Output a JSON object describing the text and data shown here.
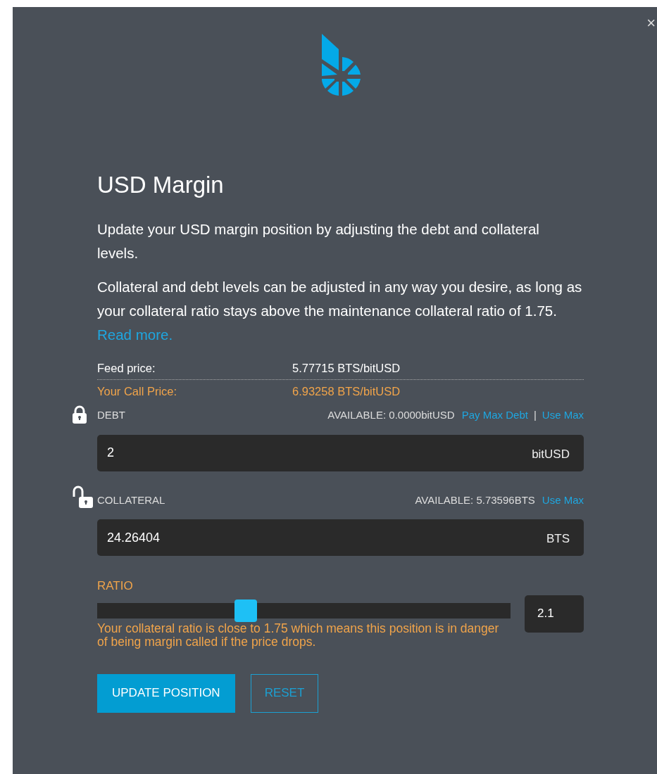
{
  "close": "×",
  "title": "USD Margin",
  "intro": "Update your USD margin position by adjusting the debt and collateral levels.",
  "description": "Collateral and debt levels can be adjusted in any way you desire, as long as your collateral ratio stays above the maintenance collateral ratio of 1.75.",
  "read_more": "Read more.",
  "prices": [
    {
      "label": "Feed price:",
      "value": "5.77715 BTS/bitUSD",
      "kind": "feed"
    },
    {
      "label": "Your Call Price:",
      "value": "6.93258 BTS/bitUSD",
      "kind": "call"
    }
  ],
  "fields": [
    {
      "label": "DEBT",
      "locked": true,
      "available": "AVAILABLE: 0.0000bitUSD",
      "links": [
        "Pay Max Debt",
        "Use Max"
      ],
      "separator": "|",
      "value": "2",
      "unit": "bitUSD"
    },
    {
      "label": "COLLATERAL",
      "locked": false,
      "available": "AVAILABLE: 5.73596BTS",
      "links": [
        "Use Max"
      ],
      "value": "24.26404",
      "unit": "BTS"
    }
  ],
  "ratio": {
    "label": "RATIO",
    "level": 0.36,
    "value": "2.1",
    "warning": "Your collateral ratio is close to 1.75 which means this position is in danger of being margin called if the price drops."
  },
  "buttons": [
    {
      "label": "UPDATE POSITION",
      "kind": "primary"
    },
    {
      "label": "RESET",
      "kind": "outline"
    }
  ]
}
